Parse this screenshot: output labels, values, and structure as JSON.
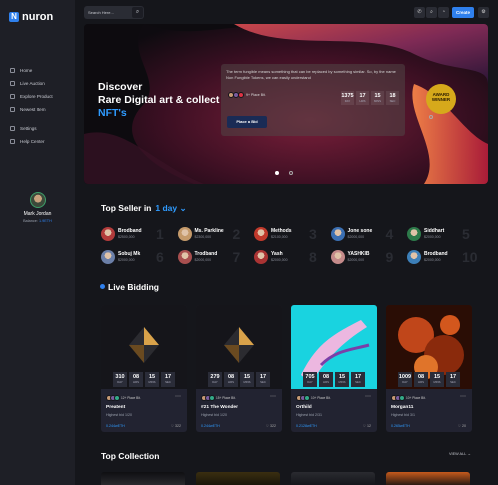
{
  "brand": {
    "letter": "N",
    "name": "nuron"
  },
  "sidebar": {
    "items": [
      {
        "label": "Home"
      },
      {
        "label": "Live Auction"
      },
      {
        "label": "Explore Product"
      },
      {
        "label": "Newest Item"
      }
    ],
    "items2": [
      {
        "label": "Settings"
      },
      {
        "label": "Help Center"
      }
    ],
    "user": {
      "name": "Mark Jordan",
      "balance_label": "Balance:",
      "balance_value": "1.9ETH"
    }
  },
  "topbar": {
    "search_placeholder": "Search Here...",
    "search_icon": "search-icon",
    "buttons": [
      {
        "icon": "phone-icon",
        "glyph": "✆"
      },
      {
        "icon": "search-icon",
        "glyph": "⌕"
      },
      {
        "icon": "bell-icon",
        "glyph": "🔔"
      }
    ],
    "create_label": "Create",
    "settings_icon": "gear-icon"
  },
  "hero": {
    "line1": "Discover",
    "line2": "Rare Digital art & collect",
    "line3": "NFT's",
    "description": "The term fungible means something that can be replaced by something similar. So, by the name Non Fungible Tokens, we can easily understand",
    "owner_text": "9+ Place Bit.",
    "countdown": [
      {
        "n": "1375",
        "l": "DAY"
      },
      {
        "n": "17",
        "l": "HRS"
      },
      {
        "n": "15",
        "l": "MINS"
      },
      {
        "n": "18",
        "l": "SEC"
      }
    ],
    "button": "Place a Bid",
    "award": "AWARD WINNER"
  },
  "top_seller": {
    "title": "Top Seller in",
    "period": "1 day",
    "chevron": "⌄",
    "sellers": [
      {
        "name": "Brodband",
        "price": "$2500,000",
        "rank": "1",
        "color": "#b23b3b"
      },
      {
        "name": "Ms. Parkline",
        "price": "$2300,000",
        "rank": "2",
        "color": "#c59a6a"
      },
      {
        "name": "Methods",
        "price": "$2100,000",
        "rank": "3",
        "color": "#c0392b"
      },
      {
        "name": "Jone sone",
        "price": "$2000,000",
        "rank": "4",
        "color": "#3b6fb2"
      },
      {
        "name": "Siddhart",
        "price": "$2000,000",
        "rank": "5",
        "color": "#2d7a4a"
      },
      {
        "name": "Sobuj Mk",
        "price": "$2000,000",
        "rank": "6",
        "color": "#6b7fa8"
      },
      {
        "name": "Trodband",
        "price": "$2000,000",
        "rank": "7",
        "color": "#a84f4f"
      },
      {
        "name": "Yash",
        "price": "$2000,000",
        "rank": "8",
        "color": "#a33"
      },
      {
        "name": "YASHKIB",
        "price": "$2000,000",
        "rank": "9",
        "color": "#c48a8a"
      },
      {
        "name": "Brodband",
        "price": "$2000,000",
        "rank": "10",
        "color": "#3c7fb8"
      }
    ]
  },
  "live_bidding": {
    "title": "Live Bidding",
    "cards": [
      {
        "title": "Preatent",
        "bid": "Highest bid 1/20",
        "price": "0.244wETH",
        "likes": "322",
        "owners": "12+ Place Bit.",
        "countdown": [
          {
            "n": "310",
            "l": "DAY"
          },
          {
            "n": "08",
            "l": "HRS"
          },
          {
            "n": "15",
            "l": "MINS"
          },
          {
            "n": "17",
            "l": "SEC"
          }
        ]
      },
      {
        "title": "#21 The Wonder",
        "bid": "Highest bid 1/20",
        "price": "0.244wETH",
        "likes": "322",
        "owners": "15+ Place Bit.",
        "countdown": [
          {
            "n": "279",
            "l": "DAY"
          },
          {
            "n": "08",
            "l": "HRS"
          },
          {
            "n": "15",
            "l": "MINS"
          },
          {
            "n": "17",
            "l": "SEC"
          }
        ]
      },
      {
        "title": "Orthild",
        "bid": "Highest bid 2/31",
        "price": "0.2128wETH",
        "likes": "12",
        "owners": "10+ Place Bit.",
        "countdown": [
          {
            "n": "705",
            "l": "DAY"
          },
          {
            "n": "08",
            "l": "HRS"
          },
          {
            "n": "15",
            "l": "MINS"
          },
          {
            "n": "17",
            "l": "SEC"
          }
        ]
      },
      {
        "title": "Morgan11",
        "bid": "Highest bid 3/1",
        "price": "0.265wETH",
        "likes": "20",
        "owners": "10+ Place Bit.",
        "countdown": [
          {
            "n": "1009",
            "l": "DAY"
          },
          {
            "n": "08",
            "l": "HRS"
          },
          {
            "n": "15",
            "l": "MINS"
          },
          {
            "n": "17",
            "l": "SEC"
          }
        ]
      }
    ]
  },
  "top_collection": {
    "title": "Top Collection",
    "view_all": "VIEW ALL →"
  },
  "colors": {
    "accent": "#2f80ed",
    "background": "#15161b",
    "sidebar": "#1e1f26",
    "card": "#222331"
  }
}
